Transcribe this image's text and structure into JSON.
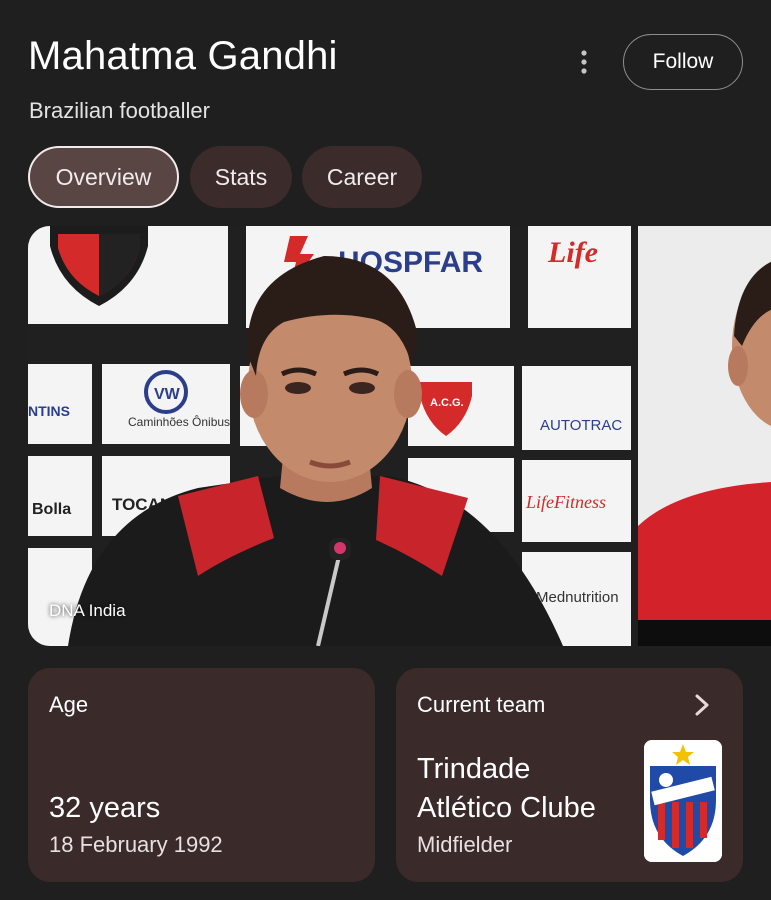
{
  "header": {
    "title": "Mahatma Gandhi",
    "subtitle": "Brazilian footballer",
    "follow_label": "Follow",
    "more_icon": "more-vert-icon"
  },
  "tabs": [
    {
      "label": "Overview",
      "active": true
    },
    {
      "label": "Stats",
      "active": false
    },
    {
      "label": "Career",
      "active": false
    }
  ],
  "photo": {
    "source": "DNA India",
    "backdrop_text": {
      "sponsor_1": "HOSPFAR",
      "sponsor_2": "Caminhões Ônibus",
      "sponsor_3": "TOCANTINS",
      "sponsor_4": "AUTOTRAC",
      "sponsor_5": "Bolla",
      "sponsor_6": "LifeFitness",
      "sponsor_7": "Life",
      "sponsor_8": "A.C.G.",
      "sponsor_9": "Mednutrition"
    }
  },
  "age_card": {
    "label": "Age",
    "value": "32 years",
    "birth_date": "18 February 1992"
  },
  "team_card": {
    "label": "Current team",
    "team_line_1": "Trindade",
    "team_line_2": "Atlético Clube",
    "position": "Midfielder",
    "chevron_icon": "chevron-right-icon"
  },
  "colors": {
    "background": "#1f1f1f",
    "card": "#3a2a2a",
    "tab": "#3b2b2b",
    "tab_active": "#5a4545"
  }
}
